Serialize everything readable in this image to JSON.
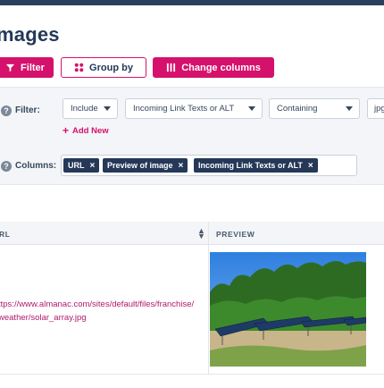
{
  "page": {
    "title": "mages"
  },
  "toolbar": {
    "filter_label": "Filter",
    "group_by_label": "Group by",
    "change_columns_label": "Change columns"
  },
  "filter_panel": {
    "filter_label": "Filter:",
    "include_value": "Include",
    "field_value": "Incoming Link Texts or ALT",
    "operator_value": "Containing",
    "search_value": "jpg",
    "add_new_label": "Add New",
    "columns_label": "Columns:",
    "column_chips": [
      {
        "label": "URL"
      },
      {
        "label": "Preview of image"
      },
      {
        "label": "Incoming Link Texts or ALT"
      }
    ]
  },
  "table": {
    "headers": {
      "url": "RL",
      "preview": "PREVIEW"
    },
    "rows": [
      {
        "url": "ttps://www.almanac.com/sites/default/files/franchise/weather/solar_array.jpg"
      }
    ]
  },
  "colors": {
    "accent": "#d6116c",
    "navy": "#253858",
    "panel_bg": "#f3f5f8",
    "link": "#b0196b"
  },
  "icons": [
    "filter-icon",
    "group-icon",
    "columns-icon",
    "help-icon",
    "plus-icon",
    "close-icon",
    "sort-icon",
    "caret-down-icon"
  ]
}
